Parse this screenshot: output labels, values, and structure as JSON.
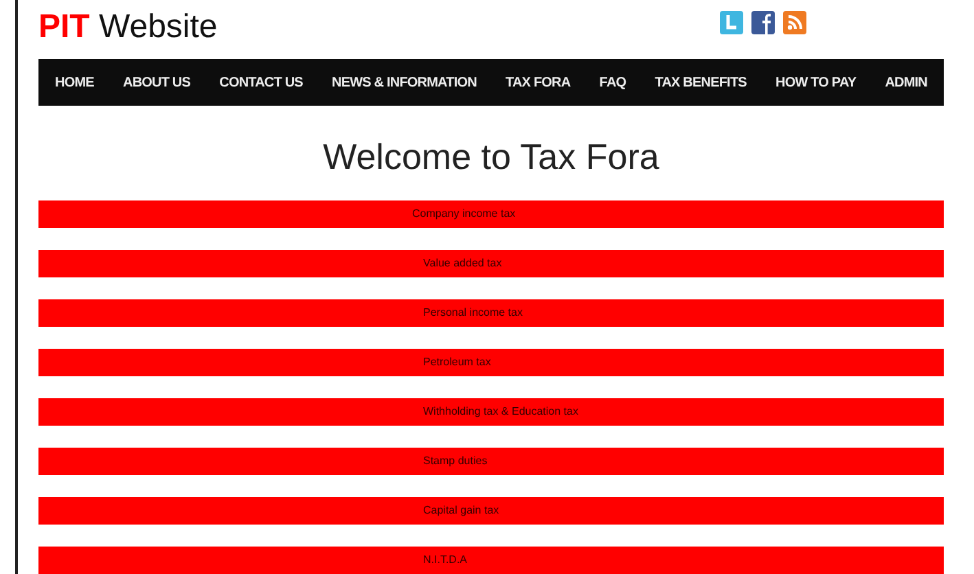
{
  "logo": {
    "accent": "PIT",
    "rest": "Website"
  },
  "social": [
    {
      "kind": "twitter"
    },
    {
      "kind": "facebook"
    },
    {
      "kind": "rss"
    }
  ],
  "nav": [
    "HOME",
    "ABOUT US",
    "CONTACT US",
    "NEWS & INFORMATION",
    "TAX FORA",
    "FAQ",
    "TAX BENEFITS",
    "HOW TO PAY",
    "ADMIN"
  ],
  "heading": "Welcome to Tax Fora",
  "topics": [
    "Company income tax",
    "Value added tax",
    "Personal income tax",
    "Petroleum tax",
    "Withholding tax & Education tax",
    "Stamp duties",
    "Capital gain tax",
    "N.I.T.D.A"
  ]
}
